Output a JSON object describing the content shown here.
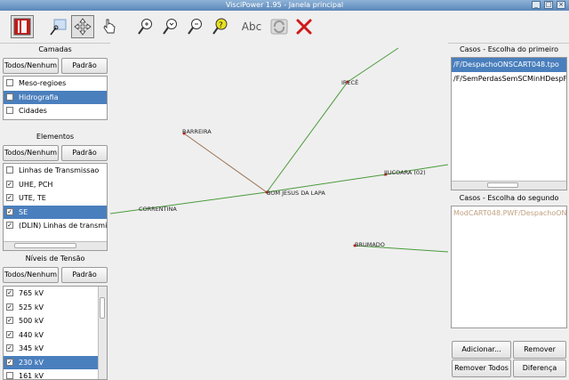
{
  "window": {
    "title": "VisciPower 1.95 - Janela principal"
  },
  "toolbar": {
    "text_tool_label": "Abc"
  },
  "left": {
    "camadas": {
      "title": "Camadas",
      "btn_all": "Todos/Nenhum",
      "btn_default": "Padrão",
      "items": [
        {
          "label": "Meso-regioes",
          "checked": false,
          "selected": false
        },
        {
          "label": "Hidrografia",
          "checked": false,
          "selected": true
        },
        {
          "label": "Cidades",
          "checked": false,
          "selected": false
        }
      ]
    },
    "elementos": {
      "title": "Elementos",
      "btn_all": "Todos/Nenhum",
      "btn_default": "Padrão",
      "items": [
        {
          "label": "Linhas de Transmissao",
          "checked": false,
          "selected": false
        },
        {
          "label": "UHE, PCH",
          "checked": true,
          "selected": false
        },
        {
          "label": "UTE, TE",
          "checked": true,
          "selected": false
        },
        {
          "label": "SE",
          "checked": true,
          "selected": true
        },
        {
          "label": "(DLIN) Linhas de transmis",
          "checked": true,
          "selected": false
        }
      ]
    },
    "niveis": {
      "title": "Níveis de Tensão",
      "btn_all": "Todos/Nenhum",
      "btn_default": "Padrão",
      "items": [
        {
          "label": "765 kV",
          "checked": true,
          "selected": false
        },
        {
          "label": "525 kV",
          "checked": true,
          "selected": false
        },
        {
          "label": "500 kV",
          "checked": true,
          "selected": false
        },
        {
          "label": "440 kV",
          "checked": true,
          "selected": false
        },
        {
          "label": "345 kV",
          "checked": true,
          "selected": false
        },
        {
          "label": "230 kV",
          "checked": true,
          "selected": true
        },
        {
          "label": "161 kV",
          "checked": false,
          "selected": false
        }
      ]
    }
  },
  "map": {
    "labels": {
      "irece": "IRECÊ",
      "barreira": "BARREIRA",
      "bom_jesus": "BOM JESUS DA LAPA",
      "correntina": "CORRENTINA",
      "jiucoara": "JIUCOARA (02)",
      "brumado": "BRUMADO"
    },
    "colors": {
      "line_green": "#4a9a3a",
      "line_brown": "#9a7050",
      "node": "#cc2222"
    }
  },
  "right": {
    "first": {
      "title": "Casos - Escolha do primeiro",
      "items": [
        {
          "label": "/F/DespachoONSCART048.tpo",
          "selected": true
        },
        {
          "label": "/F/SemPerdasSemSCMinHDespF",
          "selected": false
        }
      ]
    },
    "second": {
      "title": "Casos - Escolha do segundo",
      "items": [
        {
          "label": "ModCART048.PWF/DespachoON",
          "selected": false
        }
      ]
    },
    "buttons": {
      "add": "Adicionar...",
      "remove": "Remover",
      "remove_all": "Remover Todos",
      "diff": "Diferença"
    }
  }
}
